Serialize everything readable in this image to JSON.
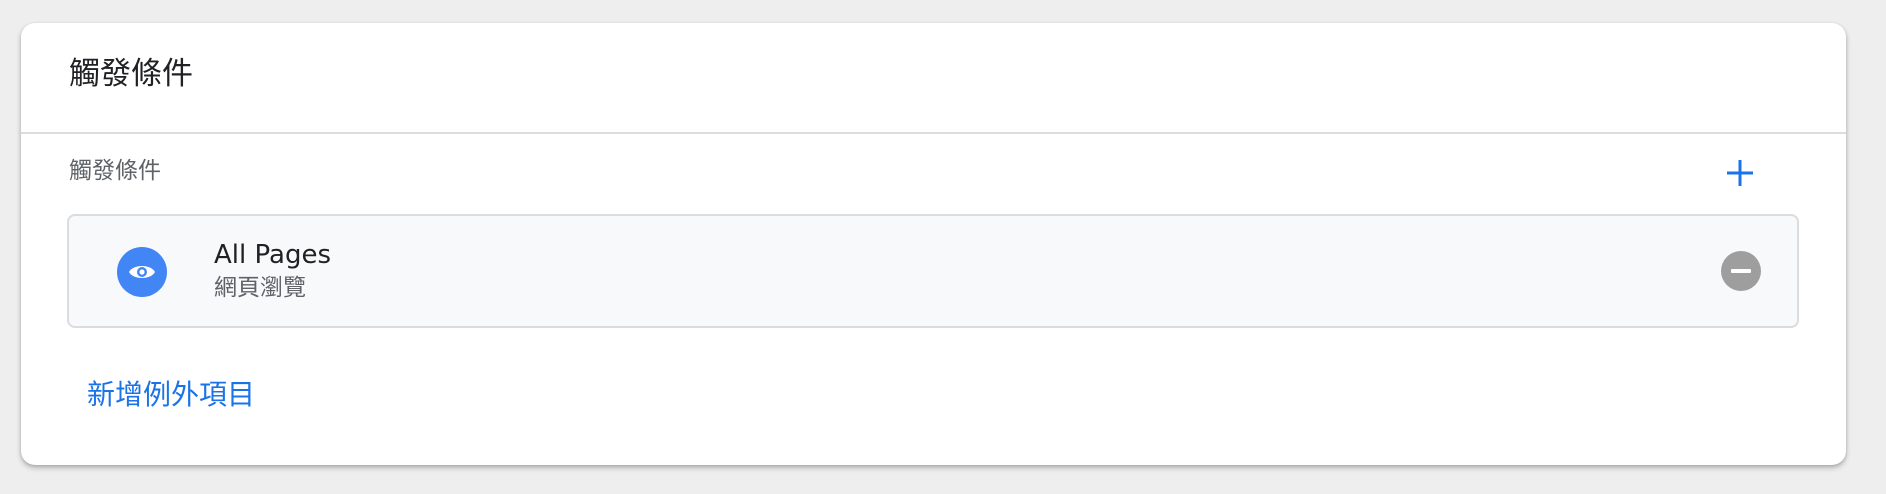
{
  "header": {
    "title": "觸發條件"
  },
  "section": {
    "label": "觸發條件",
    "add_icon": "plus-icon"
  },
  "triggers": [
    {
      "name": "All Pages",
      "type": "網頁瀏覽",
      "icon": "eye-icon",
      "icon_color": "#4285f4",
      "remove_icon": "remove-circle-icon"
    }
  ],
  "footer": {
    "add_exception_label": "新增例外項目"
  },
  "colors": {
    "accent": "#1a73e8",
    "trigger_icon_bg": "#4285f4",
    "remove_icon_bg": "#9e9e9e"
  }
}
